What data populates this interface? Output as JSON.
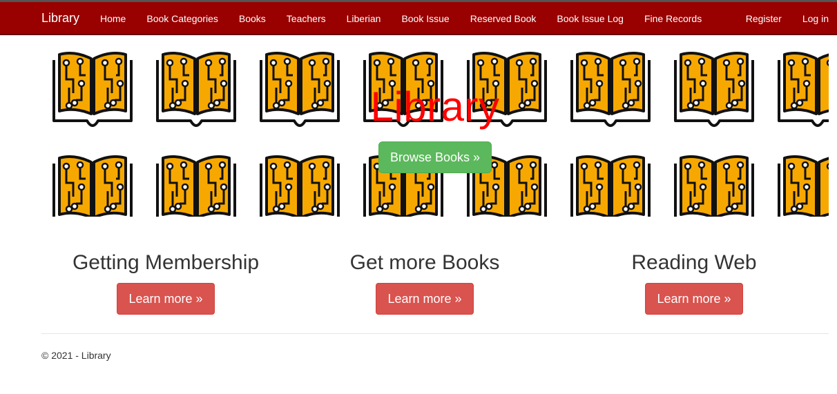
{
  "navbar": {
    "brand": "Library",
    "links": [
      "Home",
      "Book Categories",
      "Books",
      "Teachers",
      "Liberian",
      "Book Issue",
      "Reserved Book",
      "Book Issue Log",
      "Fine Records"
    ],
    "right_links": [
      "Register",
      "Log in"
    ]
  },
  "hero": {
    "title": "Library",
    "button": "Browse Books »",
    "image": "open-book-icon"
  },
  "features": [
    {
      "title": "Getting Membership",
      "button": "Learn more »"
    },
    {
      "title": "Get more Books",
      "button": "Learn more »"
    },
    {
      "title": "Reading Web",
      "button": "Learn more »"
    }
  ],
  "footer": {
    "text": "© 2021 - Library"
  },
  "colors": {
    "navbar": "#990000",
    "hero_title": "#ff0000",
    "browse_button": "#5cb85c",
    "learn_button": "#d9534f",
    "book": "#f7a800"
  }
}
